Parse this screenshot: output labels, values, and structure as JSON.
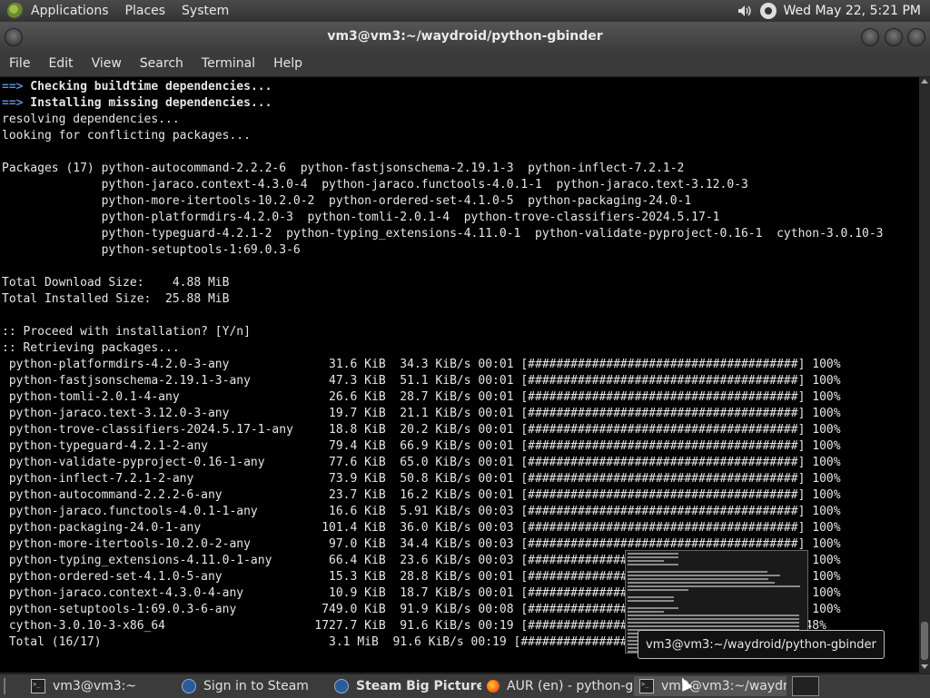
{
  "top_panel": {
    "menus": [
      "Applications",
      "Places",
      "System"
    ],
    "clock": "Wed May 22,  5:21 PM",
    "tray_icons": [
      "volume-icon",
      "steam-tray-icon"
    ]
  },
  "window": {
    "title": "vm3@vm3:~/waydroid/python-gbinder",
    "menubar": [
      "File",
      "Edit",
      "View",
      "Search",
      "Terminal",
      "Help"
    ]
  },
  "terminal": {
    "colors": {
      "background": "#000000",
      "foreground": "#e6e6e6",
      "arrow": "#5a8fe0"
    },
    "lines": [
      {
        "arrow": "==>",
        "text": " Checking buildtime dependencies...",
        "bold": true
      },
      {
        "arrow": "==>",
        "text": " Installing missing dependencies...",
        "bold": true
      },
      {
        "text": "resolving dependencies..."
      },
      {
        "text": "looking for conflicting packages..."
      },
      {
        "text": ""
      },
      {
        "text": "Packages (17) python-autocommand-2.2.2-6  python-fastjsonschema-2.19.1-3  python-inflect-7.2.1-2"
      },
      {
        "text": "              python-jaraco.context-4.3.0-4  python-jaraco.functools-4.0.1-1  python-jaraco.text-3.12.0-3"
      },
      {
        "text": "              python-more-itertools-10.2.0-2  python-ordered-set-4.1.0-5  python-packaging-24.0-1"
      },
      {
        "text": "              python-platformdirs-4.2.0-3  python-tomli-2.0.1-4  python-trove-classifiers-2024.5.17-1"
      },
      {
        "text": "              python-typeguard-4.2.1-2  python-typing_extensions-4.11.0-1  python-validate-pyproject-0.16-1  cython-3.0.10-3"
      },
      {
        "text": "              python-setuptools-1:69.0.3-6"
      },
      {
        "text": ""
      },
      {
        "text": "Total Download Size:    4.88 MiB"
      },
      {
        "text": "Total Installed Size:  25.88 MiB"
      },
      {
        "text": ""
      },
      {
        "text": ":: Proceed with installation? [Y/n]"
      },
      {
        "text": ":: Retrieving packages..."
      },
      {
        "text": " python-platformdirs-4.2.0-3-any              31.6 KiB  34.3 KiB/s 00:01 [######################################] 100%"
      },
      {
        "text": " python-fastjsonschema-2.19.1-3-any           47.3 KiB  51.1 KiB/s 00:01 [######################################] 100%"
      },
      {
        "text": " python-tomli-2.0.1-4-any                     26.6 KiB  28.7 KiB/s 00:01 [######################################] 100%"
      },
      {
        "text": " python-jaraco.text-3.12.0-3-any              19.7 KiB  21.1 KiB/s 00:01 [######################################] 100%"
      },
      {
        "text": " python-trove-classifiers-2024.5.17-1-any     18.8 KiB  20.2 KiB/s 00:01 [######################################] 100%"
      },
      {
        "text": " python-typeguard-4.2.1-2-any                 79.4 KiB  66.9 KiB/s 00:01 [######################################] 100%"
      },
      {
        "text": " python-validate-pyproject-0.16-1-any         77.6 KiB  65.0 KiB/s 00:01 [######################################] 100%"
      },
      {
        "text": " python-inflect-7.2.1-2-any                   73.9 KiB  50.8 KiB/s 00:01 [######################################] 100%"
      },
      {
        "text": " python-autocommand-2.2.2-6-any               23.7 KiB  16.2 KiB/s 00:01 [######################################] 100%"
      },
      {
        "text": " python-jaraco.functools-4.0.1-1-any          16.6 KiB  5.91 KiB/s 00:03 [######################################] 100%"
      },
      {
        "text": " python-packaging-24.0-1-any                 101.4 KiB  36.0 KiB/s 00:03 [######################################] 100%"
      },
      {
        "text": " python-more-itertools-10.2.0-2-any           97.0 KiB  34.4 KiB/s 00:03 [######################################] 100%"
      },
      {
        "text": " python-typing_extensions-4.11.0-1-any        66.4 KiB  23.6 KiB/s 00:03 [######################################] 100%"
      },
      {
        "text": " python-ordered-set-4.1.0-5-any               15.3 KiB  28.8 KiB/s 00:01 [######################################] 100%"
      },
      {
        "text": " python-jaraco.context-4.3.0-4-any            10.9 KiB  18.7 KiB/s 00:01 [######################################] 100%"
      },
      {
        "text": " python-setuptools-1:69.0.3-6-any            749.0 KiB  91.9 KiB/s 00:08 [######################################] 100%"
      },
      {
        "text": " cython-3.0.10-3-x86_64                     1727.7 KiB  91.6 KiB/s 00:19 [##################------------------]  48%"
      },
      {
        "text": " Total (16/17)                                3.1 MiB  91.6 KiB/s 00:19 [######################################]  63%"
      }
    ]
  },
  "preview": {
    "tooltip": "vm3@vm3:~/waydroid/python-gbinder"
  },
  "taskbar": {
    "tasks": [
      {
        "label": "vm3@vm3:~",
        "icon": "terminal-icon"
      },
      {
        "label": "Sign in to Steam",
        "icon": "steam-icon"
      },
      {
        "label": "Steam Big Picture ...",
        "icon": "steam-icon",
        "bold": true
      },
      {
        "label": "AUR (en) - python-g...",
        "icon": "firefox-icon"
      },
      {
        "label": "vm3@vm3:~/waydr...",
        "icon": "terminal-icon",
        "active": true
      }
    ]
  }
}
